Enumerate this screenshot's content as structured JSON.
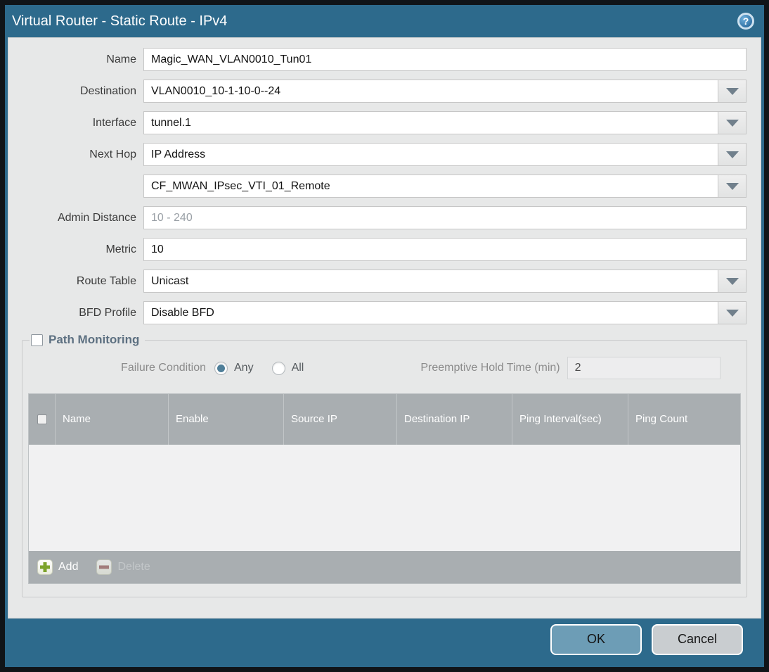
{
  "titlebar": {
    "title": "Virtual Router - Static Route - IPv4",
    "help_glyph": "?"
  },
  "form": {
    "name": {
      "label": "Name",
      "value": "Magic_WAN_VLAN0010_Tun01"
    },
    "destination": {
      "label": "Destination",
      "value": "VLAN0010_10-1-10-0--24"
    },
    "interface": {
      "label": "Interface",
      "value": "tunnel.1"
    },
    "next_hop": {
      "label": "Next Hop",
      "value": "IP Address"
    },
    "next_hop_address": {
      "value": "CF_MWAN_IPsec_VTI_01_Remote"
    },
    "admin_distance": {
      "label": "Admin Distance",
      "placeholder": "10 - 240",
      "value": ""
    },
    "metric": {
      "label": "Metric",
      "value": "10"
    },
    "route_table": {
      "label": "Route Table",
      "value": "Unicast"
    },
    "bfd_profile": {
      "label": "BFD Profile",
      "value": "Disable BFD"
    }
  },
  "path_monitoring": {
    "title": "Path Monitoring",
    "checked": false,
    "failure_condition_label": "Failure Condition",
    "option_any": "Any",
    "option_all": "All",
    "selected_option": "Any",
    "preemptive_label": "Preemptive Hold Time (min)",
    "preemptive_value": "2",
    "table": {
      "columns": [
        "Name",
        "Enable",
        "Source IP",
        "Destination IP",
        "Ping Interval(sec)",
        "Ping Count"
      ],
      "rows": []
    },
    "add_label": "Add",
    "delete_label": "Delete",
    "delete_enabled": false
  },
  "footer": {
    "ok_label": "OK",
    "cancel_label": "Cancel"
  },
  "colors": {
    "titlebar_teal": "#2d6a8c",
    "panel_gray": "#e7e8e8",
    "table_header_gray": "#a9aeb1",
    "ok_button": "#6d9db6",
    "cancel_button": "#c9cdd0",
    "add_icon_green": "#7ca32b",
    "delete_icon_red": "#a06767",
    "radio_selected": "#4f7f99"
  }
}
